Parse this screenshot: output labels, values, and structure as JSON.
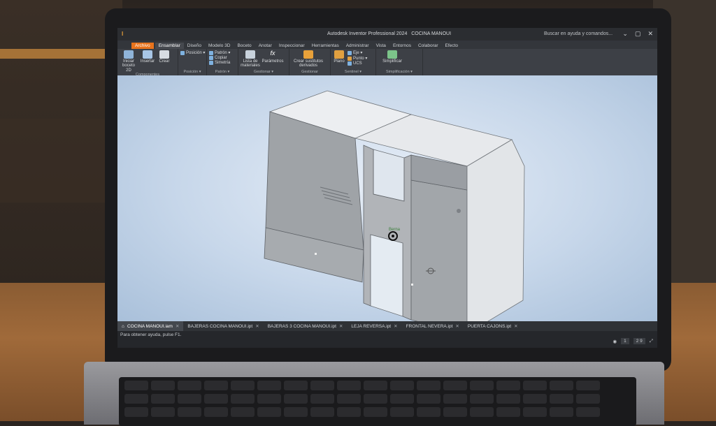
{
  "app": {
    "title": "Autodesk Inventor Professional 2024",
    "document": "COCINA MANOUI",
    "search_placeholder": "Buscar en ayuda y comandos...",
    "window_buttons": [
      "⌄",
      "▢",
      "✕"
    ]
  },
  "menu": {
    "file": "Archivo",
    "items": [
      "Ensamblar",
      "Diseño",
      "Modelo 3D",
      "Boceto",
      "Anotar",
      "Inspeccionar",
      "Herramientas",
      "Administrar",
      "Vista",
      "Entornos",
      "Colaborar",
      "Efecto"
    ],
    "active": "Ensamblar"
  },
  "ribbon": {
    "groups": [
      {
        "label": "Componentes",
        "buttons": [
          {
            "label": "Iniciar boceto 2D"
          },
          {
            "label": "Insertar"
          },
          {
            "label": "Crear"
          }
        ]
      },
      {
        "label": "Posición ▾",
        "small": [
          "Posición ▾"
        ]
      },
      {
        "label": "Patrón ▾",
        "small": [
          "Patrón ▾",
          "Copiar",
          "Simetría"
        ]
      },
      {
        "label": "Gestionar ▾",
        "buttons": [
          {
            "label": "Lista de materiales"
          },
          {
            "label": "Parámetros"
          }
        ]
      },
      {
        "label": "Gestionar",
        "buttons": [
          {
            "label": "Crear sustitutos derivados"
          }
        ]
      },
      {
        "label": "Sentinel ▾",
        "buttons": [
          {
            "label": "Plano"
          }
        ],
        "small": [
          "Eje ▾",
          "Punto ▾",
          "UCS"
        ]
      },
      {
        "label": "Simplificación ▾",
        "buttons": [
          {
            "label": "Simplificar"
          }
        ]
      }
    ]
  },
  "model": {
    "viewcube_label": "Berna"
  },
  "tabs": [
    {
      "label": "COCINA MANOUI.iam",
      "active": true
    },
    {
      "label": "BAJERAS COCINA MANOUI.ipt"
    },
    {
      "label": "BAJERAS 3 COCINA MANOUI.ipt"
    },
    {
      "label": "LEJA REVERSA.ipt"
    },
    {
      "label": "FRONTAL NEVERA.ipt"
    },
    {
      "label": "PUERTA CAJONS.ipt"
    }
  ],
  "status": {
    "text": "Para obtener ayuda, pulse F1.",
    "count_a": "1",
    "count_b": "2 9"
  }
}
